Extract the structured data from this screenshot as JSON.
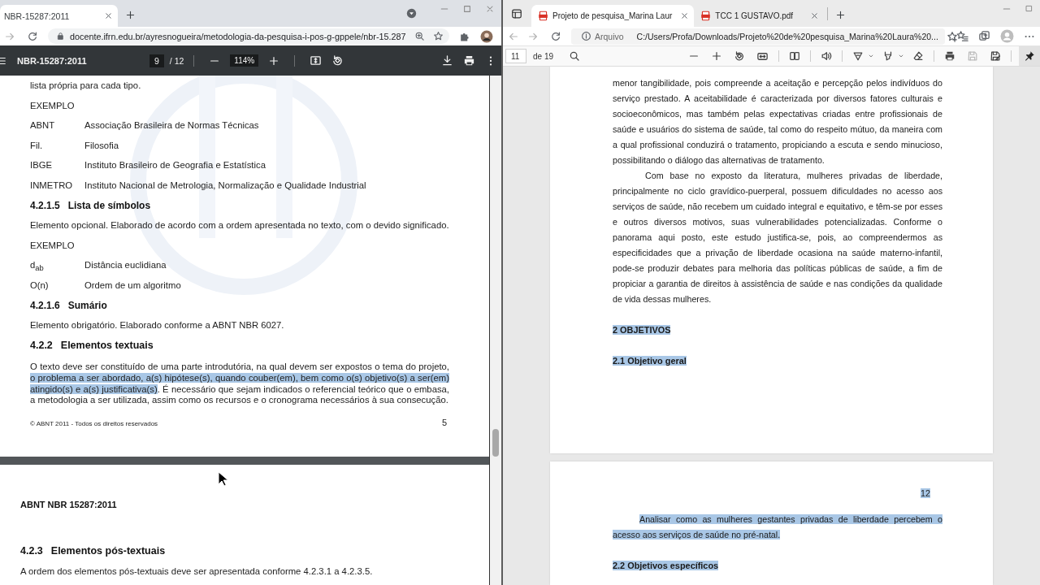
{
  "left_browser": {
    "tabs": [
      {
        "title": "NBR-15287:2011",
        "selected": true
      }
    ],
    "url": "docente.ifrn.edu.br/ayresnogueira/metodologia-da-pesquisa-i-pos-g-gppele/nbr-15.287",
    "pdf_toolbar": {
      "title": "NBR-15287:2011",
      "page": "9",
      "page_count": "/ 12",
      "zoom": "114%"
    },
    "pages": [
      {
        "blocks": [
          {
            "kind": "text",
            "text": "lista própria para cada tipo."
          },
          {
            "kind": "text",
            "text": "EXEMPLO"
          },
          {
            "kind": "def",
            "term": "ABNT",
            "definition": "Associação Brasileira de Normas Técnicas"
          },
          {
            "kind": "def",
            "term": "Fil.",
            "definition": "Filosofia"
          },
          {
            "kind": "def",
            "term": "IBGE",
            "definition": "Instituto Brasileiro de Geografia e Estatística"
          },
          {
            "kind": "def",
            "term": "INMETRO",
            "definition": "Instituto Nacional de Metrologia, Normalização e Qualidade Industrial"
          },
          {
            "kind": "subsection",
            "number": "4.2.1.5",
            "title": "Lista de símbolos"
          },
          {
            "kind": "text",
            "text": "Elemento opcional. Elaborado de acordo com a ordem apresentada no texto, com o devido significado."
          },
          {
            "kind": "text",
            "text": "EXEMPLO"
          },
          {
            "kind": "def",
            "term": "d$_{ab}$",
            "definition": "Distância euclidiana"
          },
          {
            "kind": "def",
            "term": "O(n)",
            "definition": "Ordem de um algoritmo"
          },
          {
            "kind": "subsection",
            "number": "4.2.1.6",
            "title": "Sumário"
          },
          {
            "kind": "text",
            "text": "Elemento obrigatório. Elaborado conforme a ABNT NBR 6027."
          },
          {
            "kind": "section",
            "number": "4.2.2",
            "title": "Elementos textuais"
          },
          {
            "kind": "para",
            "segments": [
              {
                "text": "O texto deve ser constituído de uma parte introdutória, na qual devem ser expostos o tema do projeto, ",
                "highlighted": false
              },
              {
                "text": "o problema a ser abordado, a(s) hipótese(s), quando couber(em), bem como o(s) objetivo(s) a ser(em) atingido(s) e a(s) justificativa(s)",
                "highlighted": true
              },
              {
                "text": ". É necessário que sejam indicados o referencial teórico que o embasa, a metodologia a ser utilizada, assim como os recursos e o cronograma necessários à sua consecução.",
                "highlighted": false
              }
            ]
          }
        ],
        "footer": "© ABNT 2011 - Todos os direitos reservados",
        "page_number": "5"
      },
      {
        "header": "ABNT NBR 15287:2011",
        "blocks": [
          {
            "kind": "section",
            "number": "4.2.3",
            "title": "Elementos pós-textuais"
          },
          {
            "kind": "text",
            "text": "A ordem dos elementos pós-textuais deve ser apresentada conforme 4.2.3.1 a 4.2.3.5."
          }
        ]
      }
    ]
  },
  "right_browser": {
    "tabs": [
      {
        "title": "Projeto de pesquisa_Marina Laur",
        "selected": true
      },
      {
        "title": "TCC 1 GUSTAVO.pdf",
        "selected": false
      }
    ],
    "site_label": "Arquivo",
    "url": "C:/Users/Profa/Downloads/Projeto%20de%20pesquisa_Marina%20Laura%20...",
    "pdf_toolbar": {
      "page": "11",
      "page_count": "de 19"
    },
    "pages": [
      {
        "blocks": [
          {
            "kind": "para",
            "indent": false,
            "highlighted": false,
            "text": "menor tangibilidade, pois compreende a aceitação e percepção pelos indivíduos do serviço prestado. A aceitabilidade é caracterizada por diversos fatores culturais e socioeconômicos, mas também pelas expectativas criadas entre profissionais de saúde e usuários do sistema de saúde, tal como do respeito mútuo, da maneira com a qual profissional conduzirá o tratamento, propiciando a escuta e sendo minucioso, possibilitando o diálogo das alternativas de tratamento."
          },
          {
            "kind": "para",
            "indent": true,
            "highlighted": false,
            "text": "Com base no exposto da literatura, mulheres privadas de liberdade, principalmente no ciclo gravídico-puerperal, possuem dificuldades no acesso aos serviços de saúde, não recebem um cuidado integral e equitativo, e têm-se por esses e outros diversos motivos, suas vulnerabilidades potencializadas. Conforme o panorama aqui posto, este estudo justifica-se, pois, ao compreendermos as especificidades que a privação de liberdade ocasiona na saúde materno-infantil, pode-se produzir debates para melhoria das políticas públicas de saúde, a fim de propiciar a garantia de direitos à assistência de saúde e nas condições da qualidade de vida dessas mulheres."
          },
          {
            "kind": "heading",
            "highlighted": true,
            "text": "2 OBJETIVOS"
          },
          {
            "kind": "heading",
            "highlighted": true,
            "text": "2.1 Objetivo geral"
          }
        ]
      },
      {
        "page_number": {
          "text": "12",
          "highlighted": true
        },
        "blocks": [
          {
            "kind": "para",
            "indent": true,
            "highlighted": true,
            "text": "Analisar como as mulheres gestantes privadas de liberdade percebem o acesso aos serviços de saúde no pré-natal."
          },
          {
            "kind": "heading",
            "highlighted": true,
            "text": "2.2 Objetivos específicos"
          }
        ]
      }
    ]
  }
}
